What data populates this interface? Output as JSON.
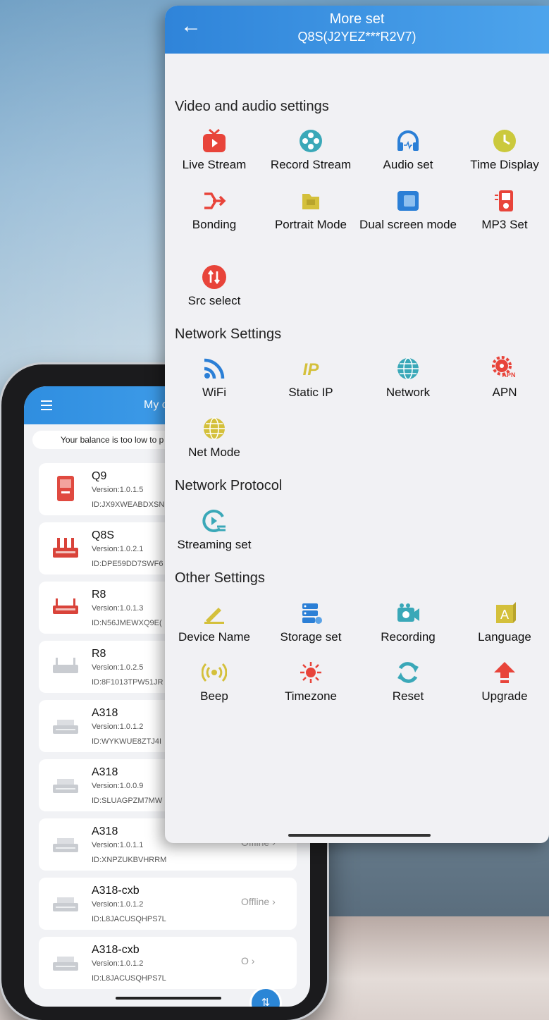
{
  "panel": {
    "title": "More set",
    "subtitle": "Q8S(J2YEZ***R2V7)",
    "back_icon": "arrow-left-icon",
    "sections": [
      {
        "title": "Video and audio settings",
        "items": [
          {
            "label": "Live Stream",
            "icon": "tv-icon",
            "color": "#e8443a"
          },
          {
            "label": "Record Stream",
            "icon": "film-reel-icon",
            "color": "#3aa8b8"
          },
          {
            "label": "Audio set",
            "icon": "headphones-icon",
            "color": "#2b7fd6"
          },
          {
            "label": "Time Display",
            "icon": "clock-icon",
            "color": "#cbc93c"
          },
          {
            "label": "Bonding",
            "icon": "merge-arrows-icon",
            "color": "#e8443a"
          },
          {
            "label": "Portrait Mode",
            "icon": "folder-icon",
            "color": "#d4c03b"
          },
          {
            "label": "Dual screen mode",
            "icon": "dual-screen-icon",
            "color": "#2b7fd6"
          },
          {
            "label": "MP3 Set",
            "icon": "mp3-player-icon",
            "color": "#e8443a"
          },
          {
            "label": "Src select",
            "icon": "swap-icon",
            "color": "#e8443a"
          }
        ]
      },
      {
        "title": "Network Settings",
        "items": [
          {
            "label": "WiFi",
            "icon": "wifi-icon",
            "color": "#2b7fd6"
          },
          {
            "label": "Static IP",
            "icon": "ip-icon",
            "color": "#d4c03b"
          },
          {
            "label": "Network",
            "icon": "globe-icon",
            "color": "#3aa8b8"
          },
          {
            "label": "APN",
            "icon": "gear-apn-icon",
            "color": "#e8443a"
          },
          {
            "label": "Net Mode",
            "icon": "globe-icon",
            "color": "#d4c03b"
          }
        ]
      },
      {
        "title": "Network Protocol",
        "items": [
          {
            "label": "Streaming set",
            "icon": "stream-play-icon",
            "color": "#3aa8b8"
          }
        ]
      },
      {
        "title": "Other Settings",
        "items": [
          {
            "label": "Device Name",
            "icon": "edit-icon",
            "color": "#d4c03b"
          },
          {
            "label": "Storage set",
            "icon": "storage-icon",
            "color": "#2b7fd6"
          },
          {
            "label": "Recording",
            "icon": "camera-icon",
            "color": "#3aa8b8"
          },
          {
            "label": "Language",
            "icon": "language-icon",
            "color": "#d4c03b"
          },
          {
            "label": "Beep",
            "icon": "beep-icon",
            "color": "#d4c03b"
          },
          {
            "label": "Timezone",
            "icon": "sun-icon",
            "color": "#e8443a"
          },
          {
            "label": "Reset",
            "icon": "refresh-icon",
            "color": "#3aa8b8"
          },
          {
            "label": "Upgrade",
            "icon": "upload-arrow-icon",
            "color": "#e8443a"
          }
        ]
      }
    ]
  },
  "phone": {
    "title": "My c",
    "notice": "Your balance is too low to p",
    "devices": [
      {
        "name": "Q9",
        "version": "Version:1.0.1.5",
        "id": "ID:JX9XWEABDXSN",
        "status": "",
        "icon": "red-device-icon"
      },
      {
        "name": "Q8S",
        "version": "Version:1.0.2.1",
        "id": "ID:DPE59DD7SWF6",
        "status": "",
        "icon": "red-encoder-icon"
      },
      {
        "name": "R8",
        "version": "Version:1.0.1.3",
        "id": "ID:N56JMEWXQ9E(",
        "status": "",
        "icon": "red-router-icon"
      },
      {
        "name": "R8",
        "version": "Version:1.0.2.5",
        "id": "ID:8F1013TPW51JR",
        "status": "",
        "icon": "grey-router-icon"
      },
      {
        "name": "A318",
        "version": "Version:1.0.1.2",
        "id": "ID:WYKWUE8ZTJ4I",
        "status": "",
        "icon": "grey-encoder-icon"
      },
      {
        "name": "A318",
        "version": "Version:1.0.0.9",
        "id": "ID:SLUAGPZM7MW",
        "status": "",
        "icon": "grey-encoder-icon"
      },
      {
        "name": "A318",
        "version": "Version:1.0.1.1",
        "id": "ID:XNPZUKBVHRRM",
        "status": "Offline",
        "icon": "grey-encoder-icon"
      },
      {
        "name": "A318-cxb",
        "version": "Version:1.0.1.2",
        "id": "ID:L8JACUSQHPS7L",
        "status": "Offline",
        "icon": "grey-encoder-icon"
      },
      {
        "name": "A318-cxb",
        "version": "Version:1.0.1.2",
        "id": "ID:L8JACUSQHPS7L",
        "status": "O",
        "icon": "grey-encoder-icon"
      }
    ],
    "fab_icon": "swap-icon"
  }
}
